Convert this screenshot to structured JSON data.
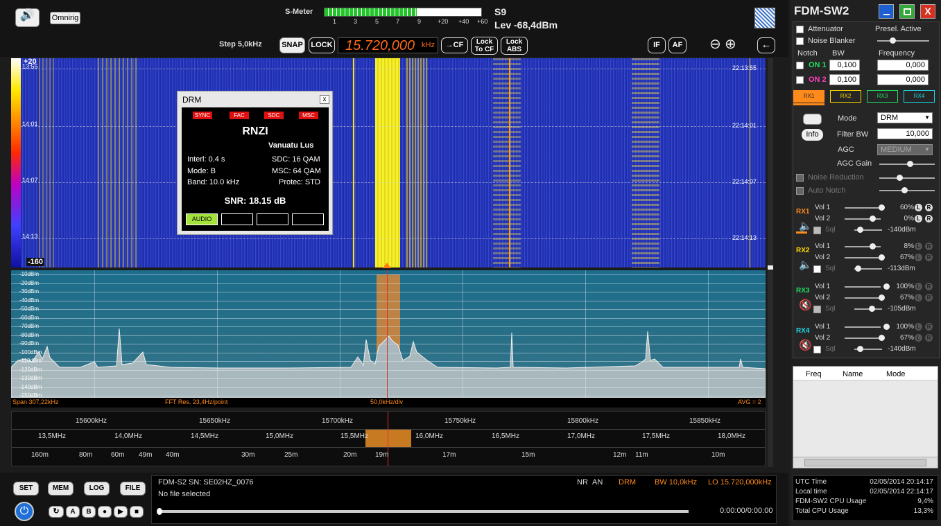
{
  "top": {
    "omnirig": "Omnirig",
    "smeter_label": "S-Meter",
    "smeter_scale": [
      "1",
      "3",
      "5",
      "7",
      "9",
      "+20",
      "+40",
      "+60"
    ],
    "s_value": "S9",
    "level": "Lev -68,4dBm",
    "smeter_fill": 0.59
  },
  "toolbar": {
    "step": "Step 5,0kHz",
    "snap": "SNAP",
    "lock": "LOCK",
    "frequency": "15.720,000",
    "freq_unit": "kHz",
    "cf": "CF",
    "lock_to_cf": "Lock\nTo CF",
    "lock_abs": "Lock\nABS",
    "if": "IF",
    "af": "AF"
  },
  "waterfall": {
    "top_db": "+20",
    "bottom_db": "-160",
    "times_left": [
      "13:55",
      "14:01",
      "14:07",
      "14:13"
    ],
    "times_right": [
      "22:13:55",
      "22:14:01",
      "22:14:07",
      "22:14:13"
    ]
  },
  "drm": {
    "title": "DRM",
    "close": "x",
    "flags": [
      "SYNC",
      "FAC",
      "SDC",
      "MSC"
    ],
    "station": "RNZI",
    "language": "Vanuatu Lus",
    "interl": "Interl: 0.4 s",
    "mode": "Mode: B",
    "band": "Band: 10.0 kHz",
    "sdc": "SDC: 16 QAM",
    "msc": "MSC: 64 QAM",
    "protec": "Protec: STD",
    "snr": "SNR: 18.15 dB",
    "audio": "AUDIO"
  },
  "spectrum": {
    "db_labels": [
      "-10dBm",
      "-20dBm",
      "-30dBm",
      "-40dBm",
      "-50dBm",
      "-60dBm",
      "-70dBm",
      "-80dBm",
      "-90dBm",
      "-100dBm",
      "-110dBm",
      "-120dBm",
      "-130dBm",
      "-140dBm",
      "-150dBm"
    ],
    "span": "Span 307,22kHz",
    "fft": "FFT Res. 23,4Hz/point",
    "div": "50,0kHz/div",
    "avg": "AVG = 2"
  },
  "scale": {
    "khz": [
      "15600kHz",
      "15650kHz",
      "15700kHz",
      "15750kHz",
      "15800kHz",
      "15850kHz"
    ],
    "mhz": [
      "13,5MHz",
      "14,0MHz",
      "14,5MHz",
      "15,0MHz",
      "15,5MHz",
      "16,0MHz",
      "16,5MHz",
      "17,0MHz",
      "17,5MHz",
      "18,0MHz"
    ],
    "bands": [
      "160m",
      "80m",
      "60m",
      "49m",
      "40m",
      "30m",
      "25m",
      "20m",
      "19m",
      "17m",
      "15m",
      "12m",
      "11m",
      "10m"
    ]
  },
  "bottom": {
    "set": "SET",
    "mem": "MEM",
    "log": "LOG",
    "file": "FILE",
    "device": "FDM-S2 SN: SE02HZ_0076",
    "file_status": "No file selected",
    "nr": "NR",
    "an": "AN",
    "mode": "DRM",
    "bw": "BW 10,0kHz",
    "lo": "LO  15.720,000kHz",
    "time": "0:00:00/0:00:00"
  },
  "right": {
    "title": "FDM-SW2",
    "attenuator": "Attenuator",
    "noise_blanker": "Noise Blanker",
    "presel": "Presel. Active",
    "notch": "Notch",
    "bw": "BW",
    "frequency": "Frequency",
    "on1": "ON 1",
    "on2": "ON 2",
    "bw1": "0,100",
    "bw2": "0,100",
    "f1": "0,000",
    "f2": "0,000",
    "rx_tabs": [
      "RX1",
      "RX2",
      "RX3",
      "RX4"
    ],
    "mode_label": "Mode",
    "mode_val": "DRM",
    "info": "Info",
    "filter_bw_label": "Filter BW",
    "filter_bw": "10,000",
    "agc_label": "AGC",
    "agc_val": "MEDIUM",
    "agc_gain": "AGC Gain",
    "noise_reduction": "Noise Reduction",
    "auto_notch": "Auto Notch",
    "rx": [
      {
        "name": "RX1",
        "vol1": "60%",
        "vol2": "0%",
        "sql": "-140dBm",
        "color": "#ff8a1c"
      },
      {
        "name": "RX2",
        "vol1": "8%",
        "vol2": "67%",
        "sql": "-113dBm",
        "color": "#ffd800"
      },
      {
        "name": "RX3",
        "vol1": "100%",
        "vol2": "67%",
        "sql": "-105dBm",
        "color": "#20e060"
      },
      {
        "name": "RX4",
        "vol1": "100%",
        "vol2": "67%",
        "sql": "-140dBm",
        "color": "#20d8e8"
      }
    ],
    "vol1_label": "Vol 1",
    "vol2_label": "Vol 2",
    "sql_label": "Sql",
    "mem_cols": [
      "Freq",
      "Name",
      "Mode"
    ],
    "stats": [
      [
        "UTC Time",
        "02/05/2014 20:14:17"
      ],
      [
        "Local time",
        "02/05/2014 22:14:17"
      ],
      [
        "FDM-SW2 CPU Usage",
        "9,4%"
      ],
      [
        "Total CPU Usage",
        "13,3%"
      ]
    ]
  }
}
